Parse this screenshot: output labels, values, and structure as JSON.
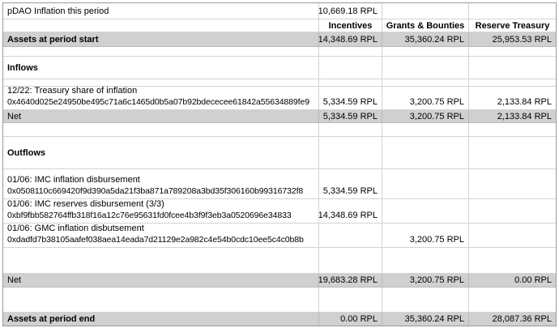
{
  "rows": {
    "inflation": {
      "label": "pDAO Inflation this period",
      "value": "10,669.18 RPL"
    },
    "headers": {
      "incentives": "Incentives",
      "grants": "Grants & Bounties",
      "reserve": "Reserve Treasury"
    },
    "assets_start": {
      "label": "Assets at period start",
      "incentives": "14,348.69 RPL",
      "grants": "35,360.24 RPL",
      "reserve": "25,953.53 RPL"
    },
    "inflows_title": "Inflows",
    "treasury_share": {
      "label": "12/22: Treasury share of inflation",
      "hash": "0x4640d025e24950be495c71a6c1465d0b5a07b92bdececee61842a55634889fe9",
      "incentives": "5,334.59 RPL",
      "grants": "3,200.75 RPL",
      "reserve": "2,133.84 RPL"
    },
    "inflows_net": {
      "label": "Net",
      "incentives": "5,334.59 RPL",
      "grants": "3,200.75 RPL",
      "reserve": "2,133.84 RPL"
    },
    "outflows_title": "Outflows",
    "imc_inflation": {
      "label": "01/06: IMC inflation disbursement",
      "hash": "0x0508110c669420f9d390a5da21f3ba871a789208a3bd35f306160b99316732f8",
      "incentives": "5,334.59 RPL"
    },
    "imc_reserves": {
      "label": "01/06: IMC reserves disbursement (3/3)",
      "hash": "0xbf9fbb582764ffb318f16a12c76e95631fd0fcee4b3f9f3eb3a0520696e34833",
      "incentives": "14,348.69 RPL"
    },
    "gmc_inflation": {
      "label": "01/06: GMC inflation disbutsement",
      "hash": "0xdadfd7b38105aafef038aea14eada7d21129e2a982c4e54b0cdc10ee5c4c0b8b",
      "grants": "3,200.75 RPL"
    },
    "outflows_net": {
      "label": "Net",
      "incentives": "19,683.28 RPL",
      "grants": "3,200.75 RPL",
      "reserve": "0.00 RPL"
    },
    "assets_end": {
      "label": "Assets at period end",
      "incentives": "0.00 RPL",
      "grants": "35,360.24 RPL",
      "reserve": "28,087.36 RPL"
    }
  }
}
